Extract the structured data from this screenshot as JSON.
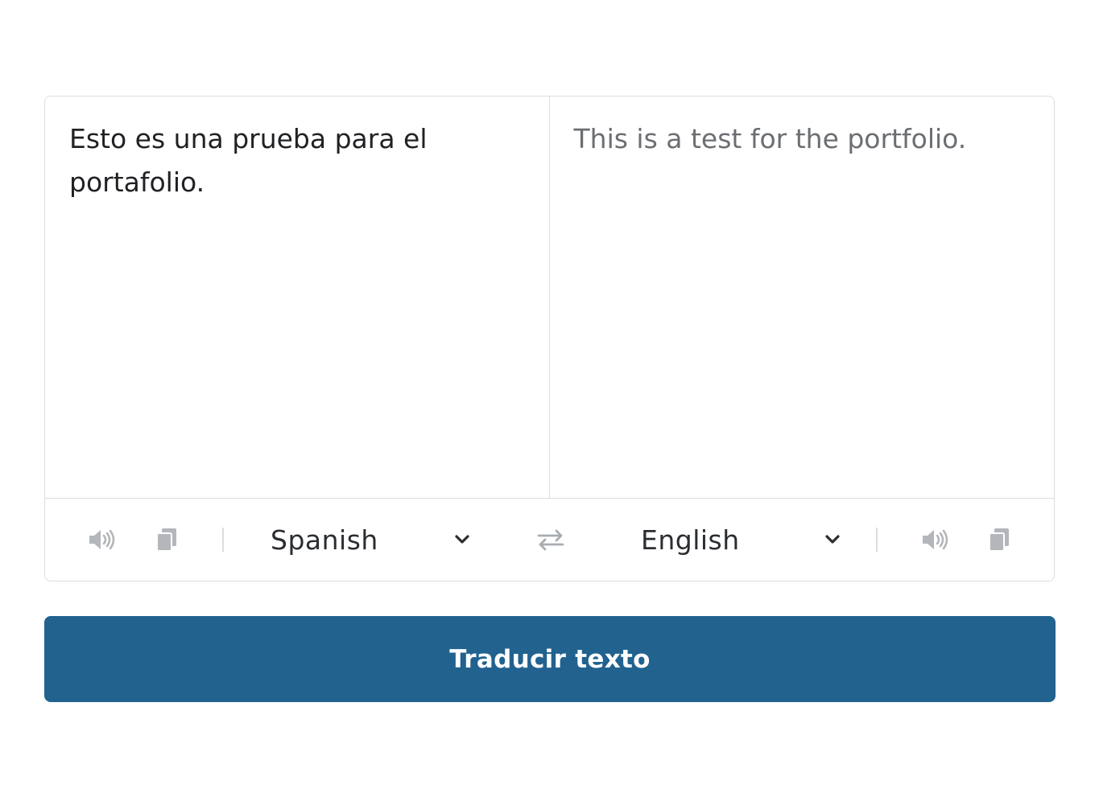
{
  "source": {
    "text": "Esto es una prueba para el portafolio.",
    "language": "Spanish"
  },
  "target": {
    "text": "This is a test for the portfolio.",
    "language": "English"
  },
  "icons": {
    "source_speak": "speaker-icon",
    "source_copy": "copy-icon",
    "swap": "swap-icon",
    "target_speak": "speaker-icon",
    "target_copy": "copy-icon",
    "dropdown": "chevron-down-icon"
  },
  "button": {
    "translate_label": "Traducir texto"
  },
  "colors": {
    "primary": "#21628f",
    "border": "#d9dde2",
    "icon": "#b3b6ba",
    "text": "#1f2124",
    "muted_text": "#6b6e72"
  }
}
